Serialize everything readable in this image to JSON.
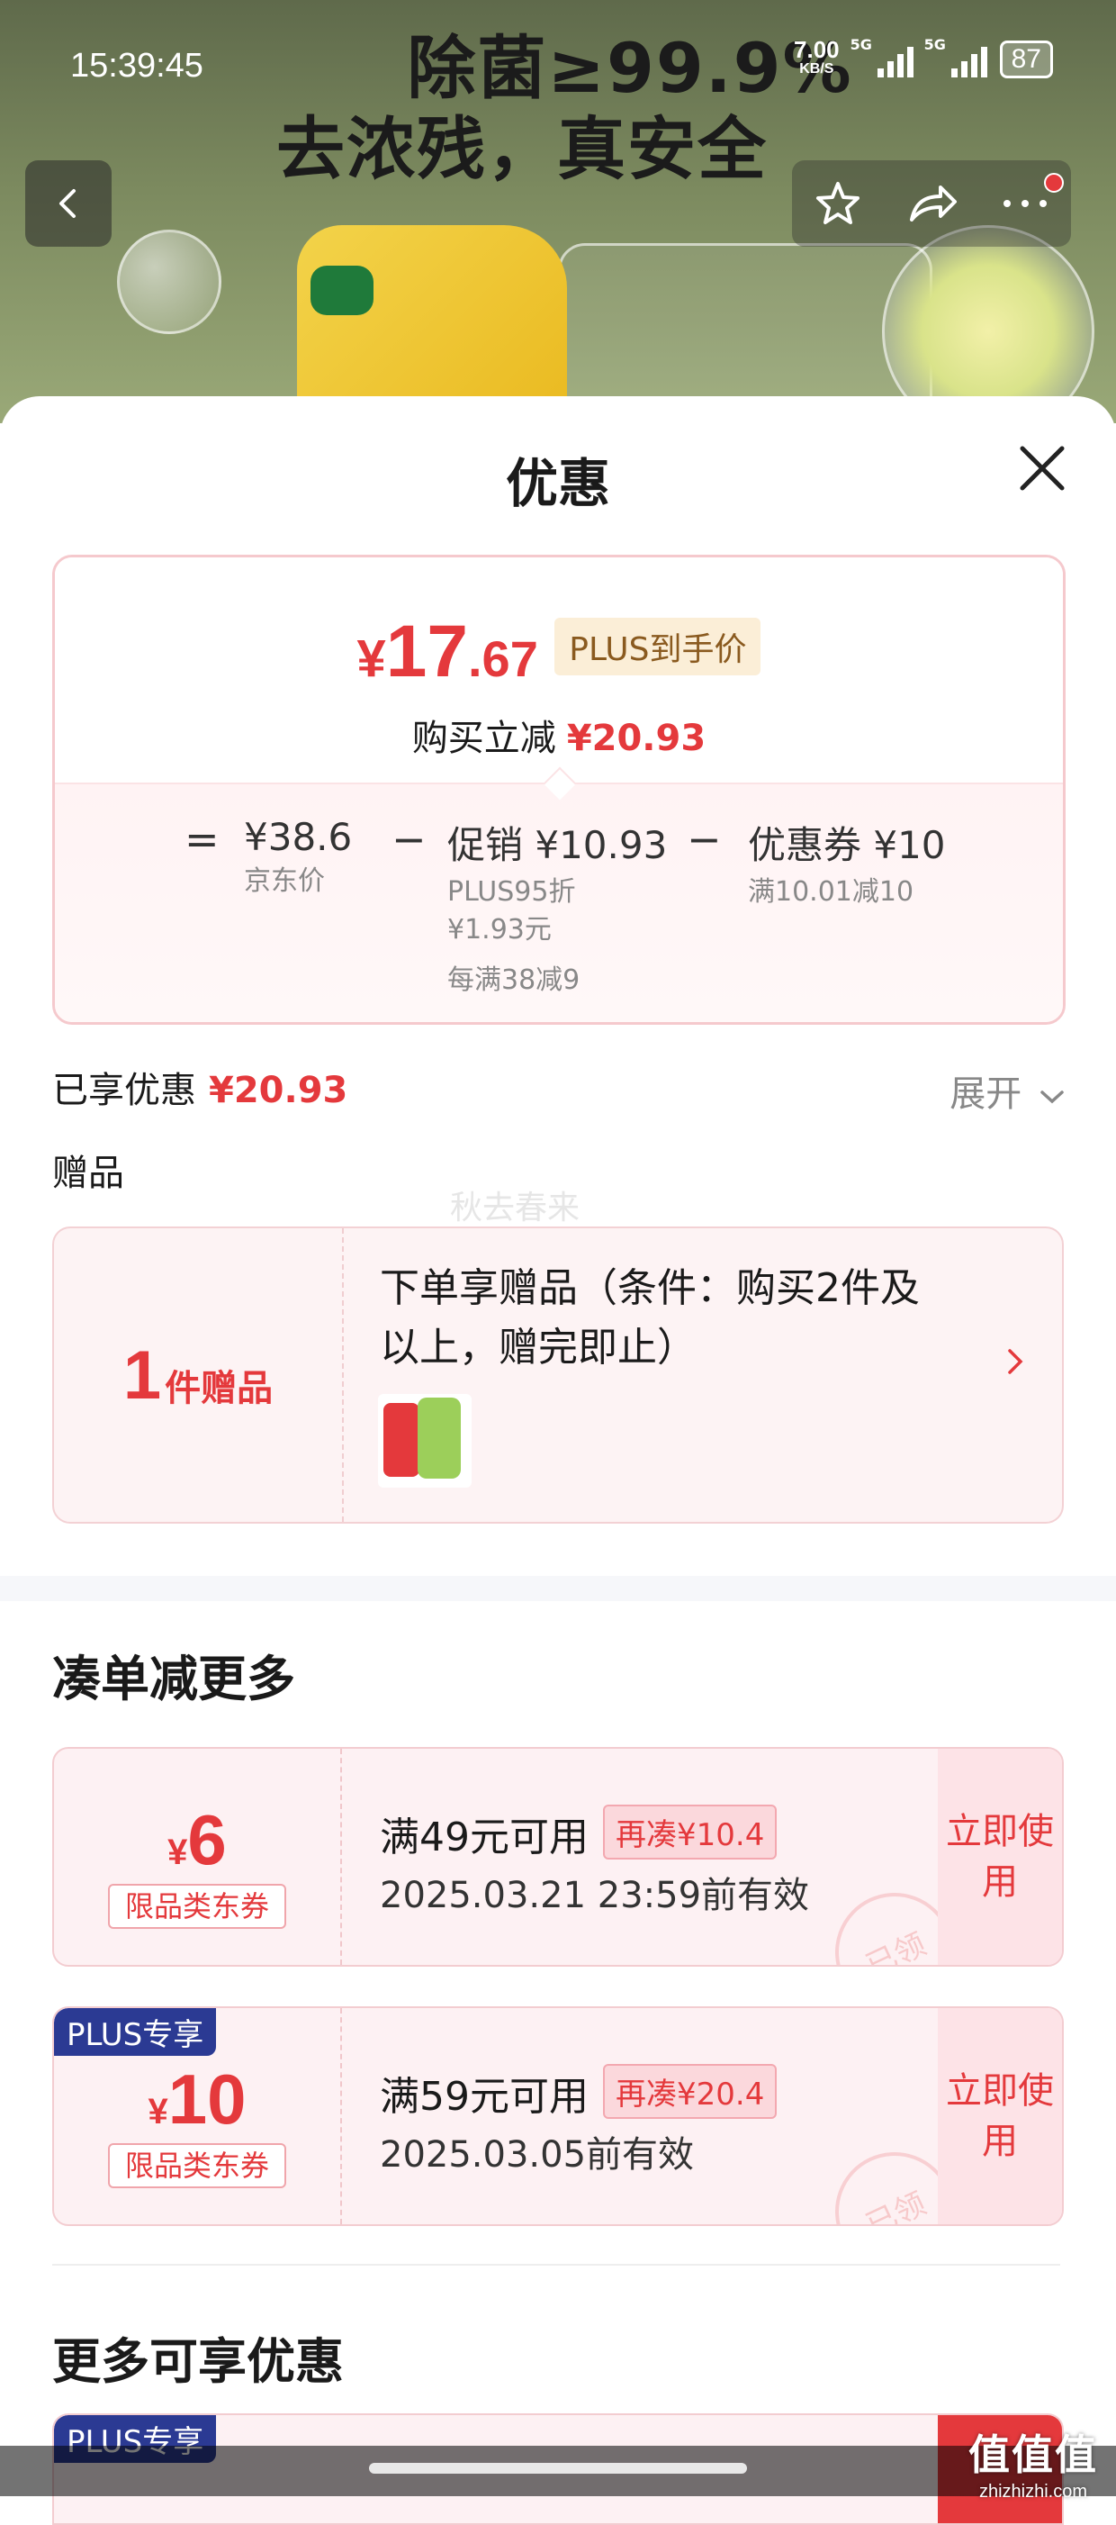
{
  "status_bar": {
    "time": "15:39:45",
    "net_speed": "7.00",
    "net_unit": "KB/S",
    "signal1": "5G",
    "signal2": "5G",
    "battery": "87"
  },
  "banner": {
    "headline1": "除菌≥99.9%",
    "headline2": "去浓残，真安全"
  },
  "sheet": {
    "title": "优惠"
  },
  "price": {
    "currency": "¥",
    "int": "17",
    "dec": ".67",
    "plus_tag": "PLUS到手价",
    "instant_cut_label": "购买立减",
    "instant_cut_amount": "¥20.93",
    "breakdown": {
      "eq": "=",
      "jd_price": "¥38.6",
      "jd_label": "京东价",
      "minus1": "−",
      "promo": "促销 ¥10.93",
      "promo_sub1": "PLUS95折",
      "promo_sub2": "¥1.93元",
      "promo_sub3": "每满38减9",
      "minus2": "−",
      "coupon": "优惠券 ¥10",
      "coupon_sub": "满10.01减10"
    }
  },
  "enjoyed": {
    "label": "已享优惠",
    "amount": "¥20.93",
    "expand": "展开"
  },
  "gift": {
    "section": "赠品",
    "watermark": "秋去春来",
    "count_num": "1",
    "count_unit": "件赠品",
    "desc": "下单享赠品（条件：购买2件及以上，赠完即止）"
  },
  "more_section": {
    "title": "凑单减更多"
  },
  "coupons": [
    {
      "currency": "¥",
      "value": "6",
      "type": "限品类东券",
      "cond": "满49元可用",
      "need": "再凑¥10.4",
      "valid": "2025.03.21 23:59前有效",
      "use": "立即使用",
      "stamp": "已领",
      "plus": ""
    },
    {
      "currency": "¥",
      "value": "10",
      "type": "限品类东券",
      "cond": "满59元可用",
      "need": "再凑¥20.4",
      "valid": "2025.03.05前有效",
      "use": "立即使用",
      "stamp": "已领",
      "plus": "PLUS专享"
    }
  ],
  "extra_section": {
    "title": "更多可享优惠",
    "plus": "PLUS专享"
  },
  "brand_watermark": {
    "big": "值值值",
    "small": "zhizhizhi.com"
  },
  "colors": {
    "accent": "#e4393c",
    "plus_blue": "#2b3a93",
    "tag_gold": "#fbeed7"
  },
  "icons": [
    "back-icon",
    "star-icon",
    "share-icon",
    "more-icon",
    "close-icon",
    "chevron-down-icon",
    "chevron-right-icon"
  ]
}
